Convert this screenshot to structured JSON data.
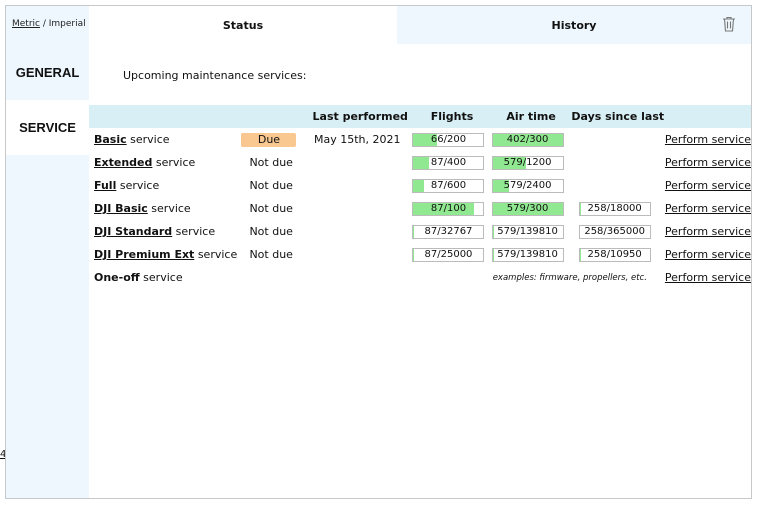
{
  "units": {
    "metric": "Metric",
    "separator": " / ",
    "imperial": "Imperial"
  },
  "sidebar": {
    "items": [
      {
        "label": "GENERAL"
      },
      {
        "label": "SERVICE",
        "active": true
      }
    ]
  },
  "tabs": [
    {
      "label": "Status",
      "active": true
    },
    {
      "label": "History"
    }
  ],
  "toolbar": {
    "delete_icon": "trash-icon"
  },
  "intro": "Upcoming maintenance services:",
  "table": {
    "headers": [
      "",
      "",
      "Last performed",
      "Flights",
      "Air time",
      "Days since last",
      ""
    ],
    "rows": [
      {
        "bold": "Basic",
        "rest": " service",
        "status": "Due",
        "due": true,
        "last": "May 15th, 2021",
        "flights": "66/200",
        "flights_pct": 33,
        "air": "402/300",
        "air_pct": 100,
        "days": "",
        "days_pct": null,
        "action": "Perform service"
      },
      {
        "bold": "Extended",
        "rest": " service",
        "status": "Not due",
        "due": false,
        "last": "",
        "flights": "87/400",
        "flights_pct": 22,
        "air": "579/1200",
        "air_pct": 48,
        "days": "",
        "days_pct": null,
        "action": "Perform service"
      },
      {
        "bold": "Full",
        "rest": " service",
        "status": "Not due",
        "due": false,
        "last": "",
        "flights": "87/600",
        "flights_pct": 15,
        "air": "579/2400",
        "air_pct": 24,
        "days": "",
        "days_pct": null,
        "action": "Perform service"
      },
      {
        "bold": "DJI Basic",
        "rest": " service",
        "status": "Not due",
        "due": false,
        "last": "",
        "flights": "87/100",
        "flights_pct": 87,
        "air": "579/300",
        "air_pct": 100,
        "days": "258/18000",
        "days_pct": 1.4,
        "action": "Perform service"
      },
      {
        "bold": "DJI Standard",
        "rest": " service",
        "status": "Not due",
        "due": false,
        "last": "",
        "flights": "87/32767",
        "flights_pct": 0.3,
        "air": "579/139810",
        "air_pct": 0.4,
        "days": "258/365000",
        "days_pct": 0.1,
        "action": "Perform service"
      },
      {
        "bold": "DJI Premium Ext",
        "rest": " service",
        "status": "Not due",
        "due": false,
        "last": "",
        "flights": "87/25000",
        "flights_pct": 0.3,
        "air": "579/139810",
        "air_pct": 0.4,
        "days": "258/10950",
        "days_pct": 2.4,
        "action": "Perform service"
      }
    ],
    "oneoff": {
      "bold": "One-off",
      "rest": " service",
      "examples": "examples: firmware, propellers, etc.",
      "action": "Perform service"
    }
  },
  "colors": {
    "sidebar_bg": "#eef7fd",
    "header_bg": "#d9eff6",
    "progress_fill": "#90e890",
    "due_badge": "#f8c890"
  },
  "stray_text": "4"
}
